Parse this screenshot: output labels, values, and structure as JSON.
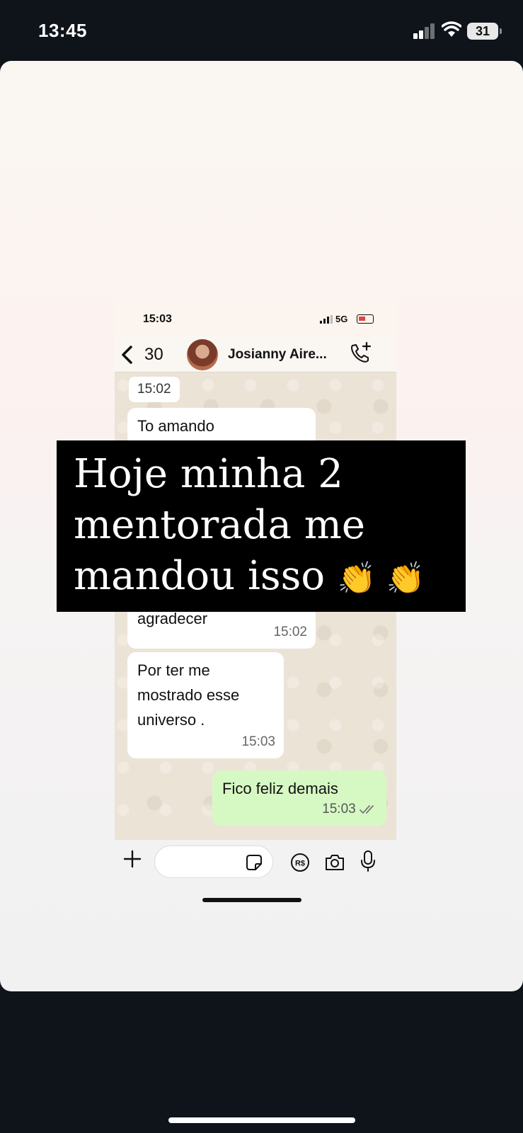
{
  "os": {
    "time": "13:45",
    "battery": "31"
  },
  "inner": {
    "time": "15:03",
    "network": "5G",
    "back_count": "30",
    "contact_name": "Josianny Aire...",
    "messages": {
      "date_chip": "15:02",
      "m1": "To amando",
      "m2_text": "agradecer",
      "m2_time": "15:02",
      "m3_text": "Por ter me mostrado esse universo .",
      "m3_time": "15:03",
      "m4_text": "Fico feliz demais",
      "m4_time": "15:03"
    }
  },
  "caption": {
    "line1": "Hoje minha 2",
    "line2": "mentorada me",
    "line3": "mandou isso",
    "emoji": "👏 👏"
  },
  "icons": {
    "back": "chevron-left-icon",
    "call": "phone-add-icon",
    "plus": "plus-icon",
    "sticker": "sticker-icon",
    "pix": "currency-rs-icon",
    "camera": "camera-icon",
    "mic": "microphone-icon"
  }
}
